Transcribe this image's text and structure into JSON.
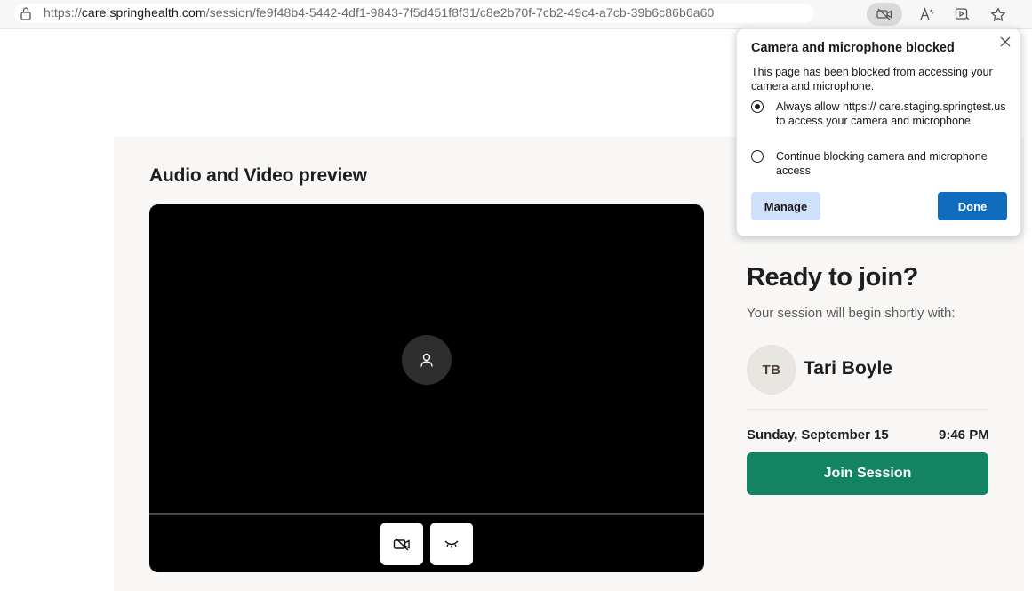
{
  "browser": {
    "url_scheme": "https://",
    "url_host": "care.springhealth.com",
    "url_path": "/session/fe9f48b4-5442-4df1-9843-7f5d451f8f31/c8e2b70f-7cb2-49c4-a7cb-39b6c86b6a60",
    "toolbar_icons": [
      "camera-blocked-icon",
      "read-aloud-icon",
      "media-icon",
      "favorite-star-icon"
    ]
  },
  "permission_popup": {
    "title": "Camera and microphone blocked",
    "description": "This page has been blocked from accessing your camera and microphone.",
    "option_allow": "Always allow https:// care.staging.springtest.us to access your camera and microphone",
    "option_block": "Continue blocking camera and microphone access",
    "selected_option": "allow",
    "manage_label": "Manage",
    "done_label": "Done"
  },
  "preview": {
    "title": "Audio and Video preview",
    "controls": [
      "camera-off-icon",
      "eye-closed-icon"
    ]
  },
  "session": {
    "heading": "Ready to join?",
    "subtitle": "Your session will begin shortly with:",
    "provider_initials": "TB",
    "provider_name": "Tari Boyle",
    "date": "Sunday, September 15",
    "time": "9:46 PM",
    "join_label": "Join Session"
  },
  "colors": {
    "join_button": "#138461",
    "done_button": "#0f6cbd",
    "manage_button": "#cfe0fa",
    "panel_background": "#f8f7f5"
  }
}
